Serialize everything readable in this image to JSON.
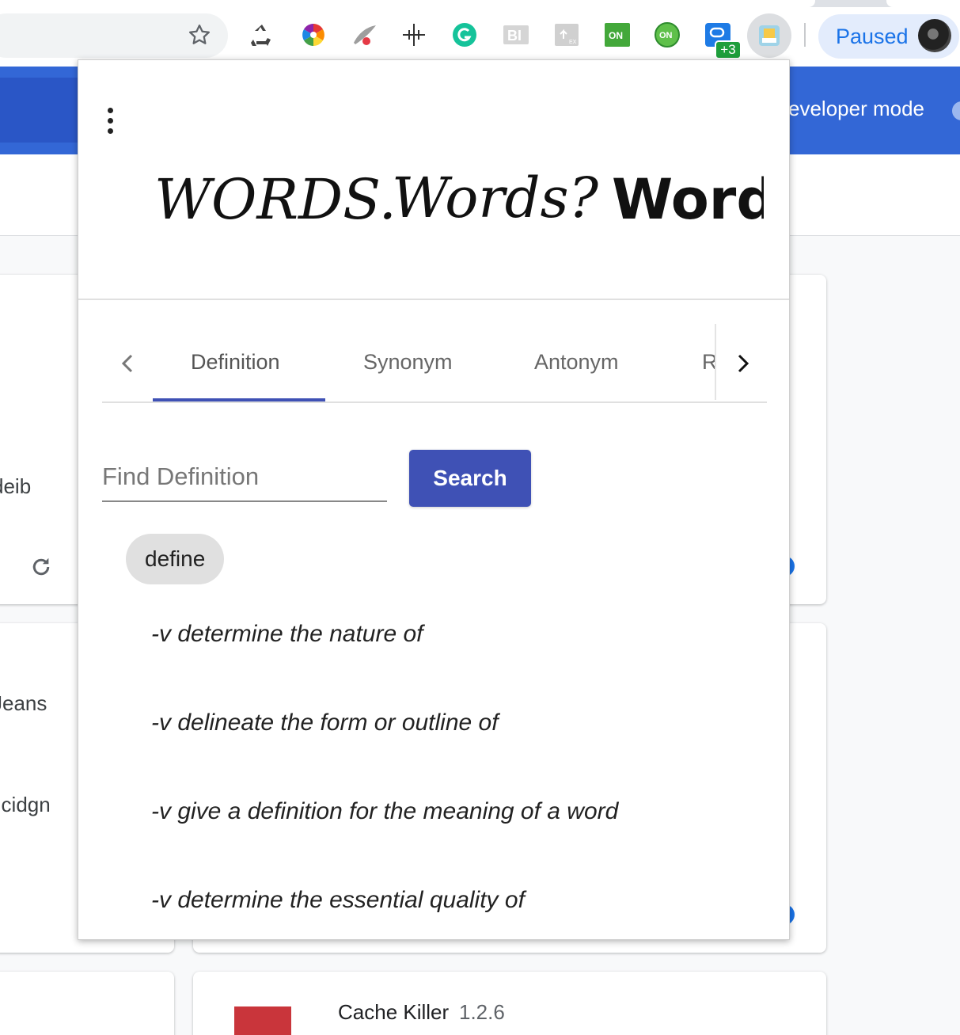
{
  "browser": {
    "paused_label": "Paused",
    "extension_badge": "+3",
    "extension_icons": [
      "recycle-icon",
      "color-wheel-icon",
      "feather-icon",
      "move-cross-icon",
      "grammarly-icon",
      "bi-icon",
      "upload-icon",
      "on-square-icon",
      "on-round-icon",
      "chat-bubble-icon"
    ],
    "active_extension_icon": "words-extension-icon"
  },
  "background_page": {
    "developer_mode_label": "eveloper mode",
    "card_fragments": [
      "deib",
      "Jeans",
      "llcidgn"
    ],
    "cache_killer": {
      "name": "Cache Killer",
      "version": "1.2.6"
    }
  },
  "popup": {
    "logo_text": [
      "WORDS.",
      "Words?",
      "Words!"
    ],
    "tabs": [
      {
        "label": "Definition",
        "active": true
      },
      {
        "label": "Synonym",
        "active": false
      },
      {
        "label": "Antonym",
        "active": false
      }
    ],
    "tab_overflow_label": "R",
    "search": {
      "placeholder": "Find Definition",
      "value": "",
      "button_label": "Search"
    },
    "word": "define",
    "definitions": [
      "-v determine the nature of",
      "-v delineate the form or outline of",
      "-v give a definition for the meaning of a word",
      "-v determine the essential quality of"
    ]
  },
  "colors": {
    "primary": "#3f51b5",
    "extensions_header": "#3367d6",
    "paused_text": "#1a73e8",
    "chip_background": "#e0e0e0"
  }
}
